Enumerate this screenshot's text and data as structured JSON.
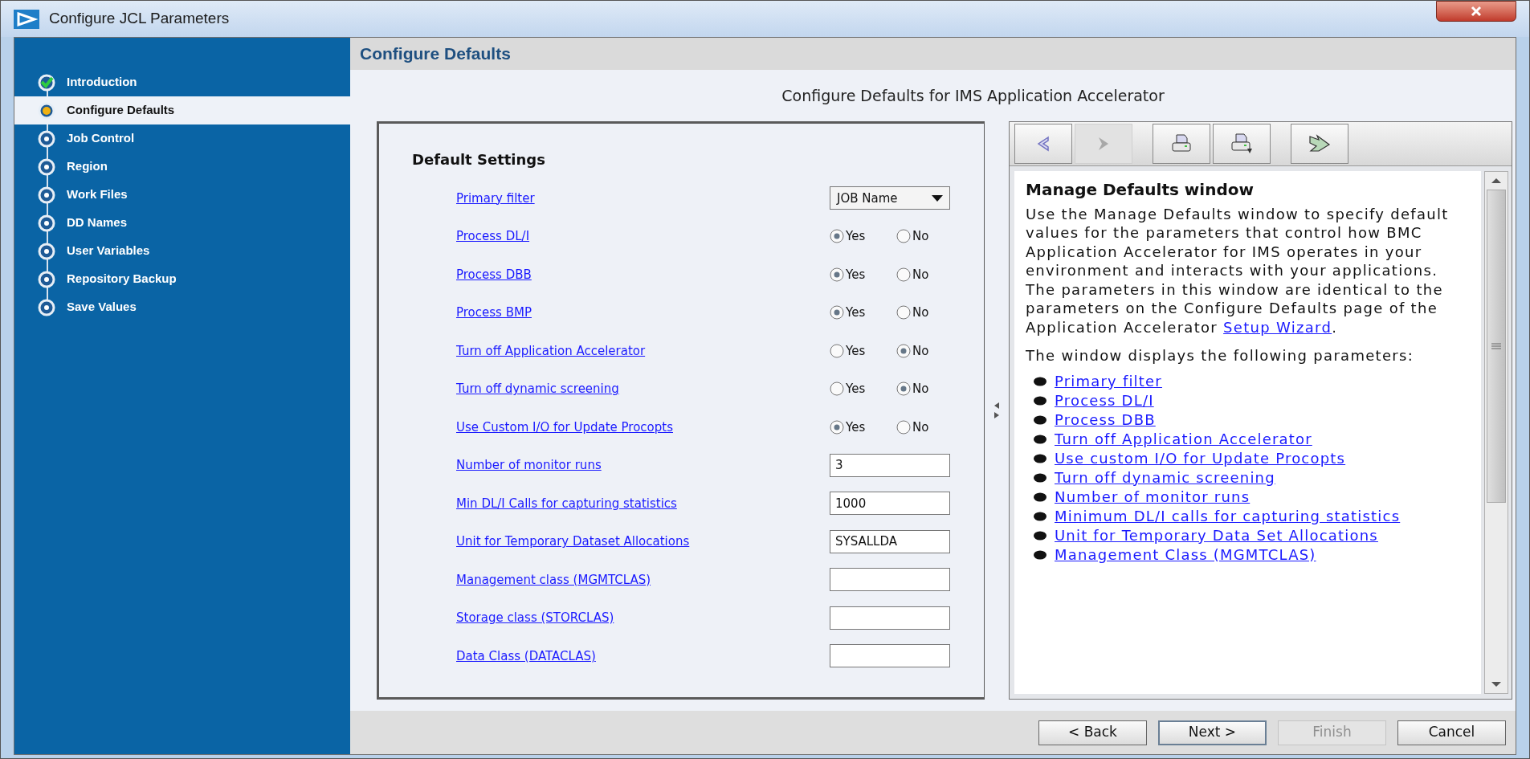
{
  "window": {
    "title": "Configure JCL Parameters"
  },
  "steps": [
    {
      "label": "Introduction",
      "completed": true,
      "selected": false
    },
    {
      "label": "Configure Defaults",
      "completed": false,
      "selected": true
    },
    {
      "label": "Job Control",
      "completed": false,
      "selected": false
    },
    {
      "label": "Region",
      "completed": false,
      "selected": false
    },
    {
      "label": "Work Files",
      "completed": false,
      "selected": false
    },
    {
      "label": "DD Names",
      "completed": false,
      "selected": false
    },
    {
      "label": "User Variables",
      "completed": false,
      "selected": false
    },
    {
      "label": "Repository Backup",
      "completed": false,
      "selected": false
    },
    {
      "label": "Save Values",
      "completed": false,
      "selected": false
    }
  ],
  "page_header": "Configure Defaults",
  "subtitle": "Configure Defaults for IMS Application Accelerator",
  "form": {
    "title": "Default Settings",
    "rows": [
      {
        "kind": "dropdown",
        "label": "Primary filter",
        "value": "JOB Name"
      },
      {
        "kind": "radio",
        "label": "Process DL/I",
        "options": [
          {
            "label": "Yes",
            "selected": true
          },
          {
            "label": "No",
            "selected": false
          }
        ]
      },
      {
        "kind": "radio",
        "label": "Process DBB",
        "options": [
          {
            "label": "Yes",
            "selected": true
          },
          {
            "label": "No",
            "selected": false
          }
        ]
      },
      {
        "kind": "radio",
        "label": "Process BMP",
        "options": [
          {
            "label": "Yes",
            "selected": true
          },
          {
            "label": "No",
            "selected": false
          }
        ]
      },
      {
        "kind": "radio",
        "label": "Turn off Application Accelerator",
        "options": [
          {
            "label": "Yes",
            "selected": false
          },
          {
            "label": "No",
            "selected": true
          }
        ]
      },
      {
        "kind": "radio",
        "label": "Turn off dynamic screening",
        "options": [
          {
            "label": "Yes",
            "selected": false
          },
          {
            "label": "No",
            "selected": true
          }
        ]
      },
      {
        "kind": "radio",
        "label": "Use Custom I/O for Update Procopts",
        "options": [
          {
            "label": "Yes",
            "selected": true
          },
          {
            "label": "No",
            "selected": false
          }
        ]
      },
      {
        "kind": "text",
        "label": "Number of monitor runs",
        "value": "3"
      },
      {
        "kind": "text",
        "label": "Min DL/I Calls for capturing statistics",
        "value": "1000"
      },
      {
        "kind": "text",
        "label": "Unit for Temporary Dataset Allocations",
        "value": "SYSALLDA"
      },
      {
        "kind": "text",
        "label": "Management class (MGMTCLAS)"
      },
      {
        "kind": "text",
        "label": "Storage class (STORCLAS)"
      },
      {
        "kind": "text",
        "label": "Data Class (DATACLAS)"
      }
    ]
  },
  "help": {
    "toolbar": [
      {
        "kind": "back",
        "disabled": false
      },
      {
        "kind": "forward",
        "disabled": true
      },
      {
        "kind": "print",
        "disabled": false
      },
      {
        "kind": "print-setup",
        "disabled": false
      },
      {
        "kind": "sync",
        "disabled": false
      }
    ],
    "heading": "Manage Defaults window",
    "intro": "Use the Manage Defaults window to specify default values for the parameters that control how BMC Application Accelerator for IMS operates in your environment and interacts with your applications. The parameters in this window are identical to the parameters on the Configure Defaults page of the Application Accelerator",
    "intro_link": "Setup Wizard",
    "intro_end": ".",
    "list_intro": "The window displays the following parameters:",
    "links": [
      "Primary filter",
      "Process DL/I",
      "Process DBB",
      "Turn off Application Accelerator",
      "Use custom I/O for Update Procopts",
      "Turn off dynamic screening",
      "Number of monitor runs",
      "Minimum DL/I calls for capturing statistics",
      "Unit for Temporary Data Set Allocations",
      "Management Class (MGMTCLAS)"
    ]
  },
  "buttons": [
    {
      "label": "< Back",
      "disabled": false,
      "default": false
    },
    {
      "label": "Next >",
      "disabled": false,
      "default": true
    },
    {
      "label": "Finish",
      "disabled": true,
      "default": false
    },
    {
      "label": "Cancel",
      "disabled": false,
      "default": false
    }
  ]
}
